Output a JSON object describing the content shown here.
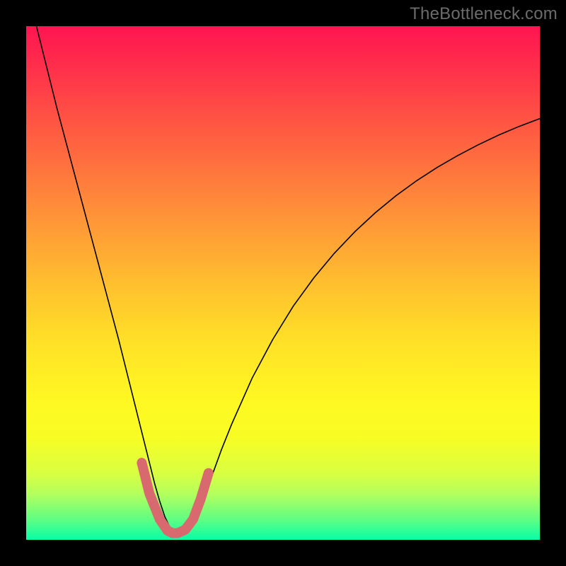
{
  "watermark": "TheBottleneck.com",
  "chart_data": {
    "type": "line",
    "title": "",
    "xlabel": "",
    "ylabel": "",
    "xlim": [
      0,
      100
    ],
    "ylim": [
      0,
      100
    ],
    "grid": false,
    "series": [
      {
        "name": "curve",
        "color": "#000000",
        "width": 1.6,
        "x": [
          2,
          4,
          6,
          8,
          10,
          12,
          14,
          16,
          18,
          20,
          21,
          22,
          23,
          24,
          25,
          26,
          27,
          28,
          29,
          30,
          32,
          34,
          36,
          38,
          40,
          44,
          48,
          52,
          56,
          60,
          64,
          68,
          72,
          76,
          80,
          84,
          88,
          92,
          96,
          100
        ],
        "y": [
          100,
          92,
          84,
          76.5,
          69,
          61.5,
          54,
          46.5,
          39,
          31,
          27,
          23,
          19,
          15,
          11,
          7.5,
          4.5,
          2.4,
          1.3,
          1.0,
          2.8,
          7.0,
          12.0,
          17.5,
          22.5,
          31.5,
          39.0,
          45.5,
          51.0,
          55.8,
          60.0,
          63.7,
          67.0,
          69.9,
          72.5,
          74.8,
          76.9,
          78.8,
          80.5,
          82.0
        ]
      },
      {
        "name": "minimum-marker",
        "color": "#d86a6f",
        "width": 14,
        "linecap": "round",
        "x": [
          22.5,
          24,
          26,
          27.5,
          28.5,
          29.5,
          31,
          32.5,
          34,
          35.5
        ],
        "y": [
          15.0,
          9.0,
          4.0,
          1.8,
          1.3,
          1.3,
          2.0,
          4.0,
          8.0,
          13.0
        ]
      }
    ]
  }
}
